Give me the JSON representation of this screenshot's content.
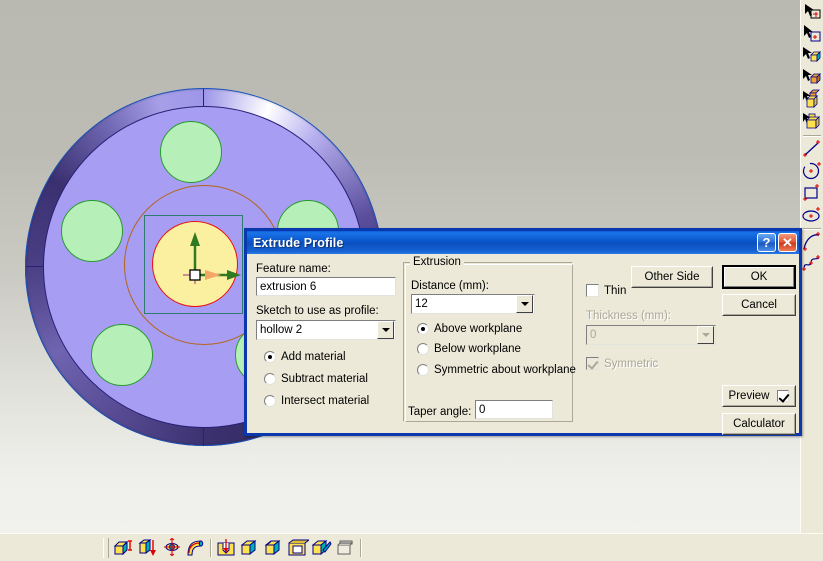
{
  "app": {
    "viewport_bg_top": "#b9b9b1",
    "viewport_bg_bottom": "#f1f1ed"
  },
  "model": {
    "name": "circular-plate-with-bolt-holes",
    "face_color": "#a79df3",
    "hole_color": "#b6efb8",
    "sketch_profile_fill": "#fbf0a0",
    "sketch_profile_outline": "#e81010",
    "sketch_box_outline": "#2e7b74",
    "sketch_construction_circle": "#b4651a",
    "axis_y_color": "#2f7a22",
    "axis_x_color": "#2f7a22",
    "origin_marker": "origin-square"
  },
  "dialog": {
    "title": "Extrude Profile",
    "help_button": "?",
    "close_button": "✕",
    "feature_name_label": "Feature name:",
    "feature_name_value": "extrusion 6",
    "sketch_label": "Sketch to use as profile:",
    "sketch_value": "hollow 2",
    "material_options": [
      {
        "label": "Add material",
        "selected": true
      },
      {
        "label": "Subtract material",
        "selected": false
      },
      {
        "label": "Intersect material",
        "selected": false
      }
    ],
    "extrusion_group_title": "Extrusion",
    "distance_label": "Distance (mm):",
    "distance_value": "12",
    "direction_options": [
      {
        "label": "Above workplane",
        "selected": true
      },
      {
        "label": "Below workplane",
        "selected": false
      },
      {
        "label": "Symmetric about workplane",
        "selected": false
      }
    ],
    "taper_label": "Taper angle:",
    "taper_value": "0",
    "thin_label": "Thin",
    "thin_checked": false,
    "thickness_label": "Thickness (mm):",
    "thickness_value": "0",
    "thickness_enabled": false,
    "symmetric_label": "Symmetric",
    "symmetric_checked": true,
    "symmetric_enabled": false,
    "other_side_label": "Other Side",
    "ok_label": "OK",
    "cancel_label": "Cancel",
    "preview_label": "Preview",
    "preview_checked": true,
    "calculator_label": "Calculator"
  },
  "right_toolbar": {
    "items": [
      {
        "name": "select-workplane-icon"
      },
      {
        "name": "select-feature-icon"
      },
      {
        "name": "select-face-icon"
      },
      {
        "name": "select-solid-icon"
      },
      {
        "name": "select-body-icon"
      },
      {
        "name": "select-assembly-icon"
      },
      {
        "name": "sketch-line-icon"
      },
      {
        "name": "sketch-circle-icon"
      },
      {
        "name": "sketch-rectangle-icon"
      },
      {
        "name": "sketch-ellipse-icon"
      },
      {
        "name": "sketch-arc-icon"
      },
      {
        "name": "sketch-spline-icon"
      }
    ]
  },
  "bottom_toolbar": {
    "items": [
      {
        "name": "extrude-profile-icon"
      },
      {
        "name": "revolve-profile-icon"
      },
      {
        "name": "sweep-profile-icon"
      },
      {
        "name": "loft-profile-icon"
      },
      {
        "name": "hole-feature-icon"
      },
      {
        "name": "chamfer-icon"
      },
      {
        "name": "fillet-icon"
      },
      {
        "name": "shell-icon"
      },
      {
        "name": "draft-icon"
      },
      {
        "name": "pattern-icon"
      }
    ]
  }
}
